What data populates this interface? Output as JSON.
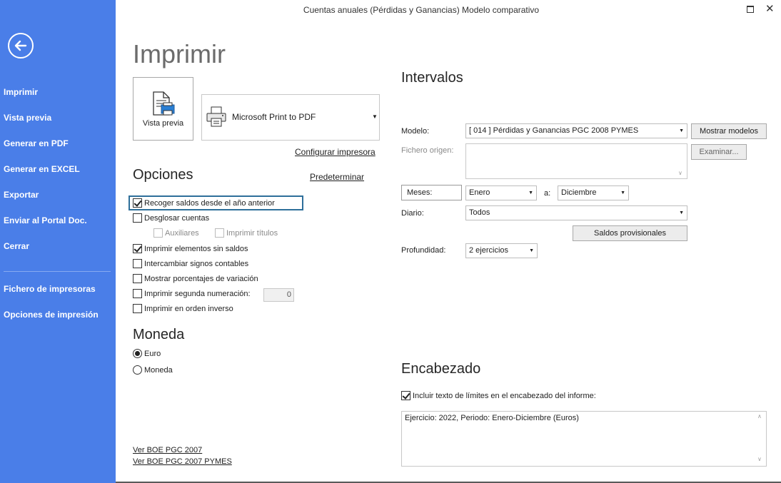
{
  "window": {
    "title": "Cuentas anuales (Pérdidas y Ganancias) Modelo comparativo"
  },
  "sidebar": {
    "items": [
      {
        "label": "Imprimir"
      },
      {
        "label": "Vista previa"
      },
      {
        "label": "Generar en PDF"
      },
      {
        "label": "Generar en EXCEL"
      },
      {
        "label": "Exportar"
      },
      {
        "label": "Enviar al Portal Doc."
      },
      {
        "label": "Cerrar"
      },
      {
        "label": "Fichero de impresoras"
      },
      {
        "label": "Opciones de impresión"
      }
    ]
  },
  "print": {
    "title": "Imprimir",
    "preview_label": "Vista previa",
    "printer": "Microsoft Print to PDF",
    "configure_label": "Configurar impresora"
  },
  "options": {
    "title": "Opciones",
    "default_label": "Predeterminar",
    "items": [
      {
        "label": "Recoger saldos desde el año anterior",
        "checked": true
      },
      {
        "label": "Desglosar cuentas",
        "checked": false
      },
      {
        "label": "Auxiliares",
        "checked": false,
        "disabled": true
      },
      {
        "label": "Imprimir títulos",
        "checked": false,
        "disabled": true
      },
      {
        "label": "Imprimir elementos sin saldos",
        "checked": true
      },
      {
        "label": "Intercambiar signos contables",
        "checked": false
      },
      {
        "label": "Mostrar porcentajes de variación",
        "checked": false
      },
      {
        "label": "Imprimir segunda numeración:",
        "checked": false
      },
      {
        "label": "Imprimir en orden inverso",
        "checked": false
      }
    ],
    "second_numbering_value": "0"
  },
  "currency": {
    "title": "Moneda",
    "options": [
      {
        "label": "Euro",
        "selected": true
      },
      {
        "label": "Moneda",
        "selected": false
      }
    ]
  },
  "links": {
    "boe_pgc": "Ver BOE PGC 2007",
    "boe_pymes": "Ver BOE PGC 2007 PYMES"
  },
  "intervals": {
    "title": "Intervalos",
    "model_label": "Modelo:",
    "model_value": "[ 014 ] Pérdidas y Ganancias PGC 2008 PYMES",
    "show_models_label": "Mostrar modelos",
    "source_label": "Fichero origen:",
    "browse_label": "Examinar...",
    "months_label": "Meses:",
    "month_from": "Enero",
    "to_label": "a:",
    "month_to": "Diciembre",
    "journal_label": "Diario:",
    "journal_value": "Todos",
    "provisional_label": "Saldos provisionales",
    "depth_label": "Profundidad:",
    "depth_value": "2 ejercicios"
  },
  "header": {
    "title": "Encabezado",
    "include_label": "Incluir texto de límites en el encabezado del informe:",
    "include_checked": true,
    "text": "Ejercicio: 2022, Periodo: Enero-Diciembre (Euros)"
  },
  "colors": {
    "sidebar": "#4a7ee8",
    "focus": "#2e6f9a"
  }
}
